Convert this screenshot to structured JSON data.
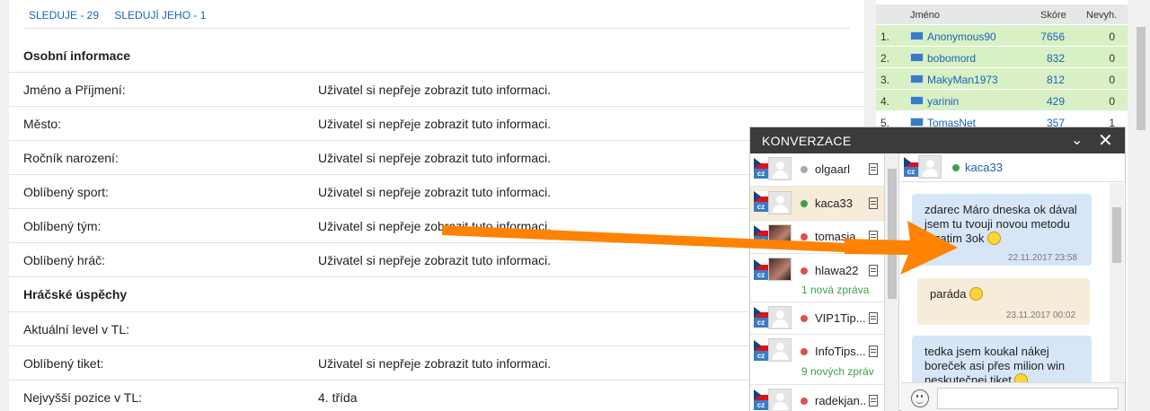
{
  "follows": {
    "following": "SLEDUJE - 29",
    "followers": "SLEDUJÍ JEHO - 1"
  },
  "section_personal": "Osobní informace",
  "section_achievements": "Hráčské úspěchy",
  "rows": [
    {
      "label": "Jméno a Příjmení:",
      "value": "Uživatel si nepřeje zobrazit tuto informaci."
    },
    {
      "label": "Město:",
      "value": "Uživatel si nepřeje zobrazit tuto informaci."
    },
    {
      "label": "Ročník narození:",
      "value": "Uživatel si nepřeje zobrazit tuto informaci."
    },
    {
      "label": "Oblíbený sport:",
      "value": "Uživatel si nepřeje zobrazit tuto informaci."
    },
    {
      "label": "Oblíbený tým:",
      "value": "Uživatel si nepřeje zobrazit tuto informaci."
    },
    {
      "label": "Oblíbený hráč:",
      "value": "Uživatel si nepřeje zobrazit tuto informaci."
    },
    {
      "label": "Aktuální level v TL:",
      "value": ""
    },
    {
      "label": "Oblíbený tiket:",
      "value": "Uživatel si nepřeje zobrazit tuto informaci."
    },
    {
      "label": "Nejvyšší pozice v TL:",
      "value": "4. třída"
    }
  ],
  "board": {
    "headers": {
      "name": "Jméno",
      "score": "Skóre",
      "miss": "Nevyh."
    },
    "rows": [
      {
        "rank": "1.",
        "name": "Anonymous90",
        "score": "7656",
        "miss": "0"
      },
      {
        "rank": "2.",
        "name": "bobomord",
        "score": "832",
        "miss": "0"
      },
      {
        "rank": "3.",
        "name": "MakyMan1973",
        "score": "812",
        "miss": "0"
      },
      {
        "rank": "4.",
        "name": "yarinin",
        "score": "429",
        "miss": "0"
      },
      {
        "rank": "5.",
        "name": "TomasNet",
        "score": "357",
        "miss": "1"
      }
    ]
  },
  "chat": {
    "title": "KONVERZACE",
    "country_code": "cz",
    "conversations": [
      {
        "name": "olgaarl",
        "status": "offline",
        "new": ""
      },
      {
        "name": "kaca33",
        "status": "online",
        "new": ""
      },
      {
        "name": "tomasja...",
        "status": "busy",
        "new": ""
      },
      {
        "name": "hlawa22",
        "status": "busy",
        "new": "1 nová zpráva"
      },
      {
        "name": "VIP1Tip...",
        "status": "busy",
        "new": ""
      },
      {
        "name": "InfoTips...",
        "status": "busy",
        "new": "9 nových zpráv"
      },
      {
        "name": "radekjan...",
        "status": "busy",
        "new": ""
      }
    ],
    "active_contact": "kaca33",
    "messages": [
      {
        "dir": "in",
        "text": "zdarec Máro dneska ok dával jsem tu tvouji novou metodu a zatim 3ok",
        "time": "22.11.2017 23:58"
      },
      {
        "dir": "out",
        "text": "paráda",
        "time": "23.11.2017 00:02"
      },
      {
        "dir": "in",
        "text": "tedka jsem koukal nákej boreček asi přes milion win neskutečnej tiket",
        "time": ""
      }
    ]
  },
  "colors": {
    "accent": "#1a63b5",
    "arrow": "#ff8200",
    "online": "#3ba24a",
    "busy": "#d9534f",
    "offline": "#aaaaaa"
  }
}
